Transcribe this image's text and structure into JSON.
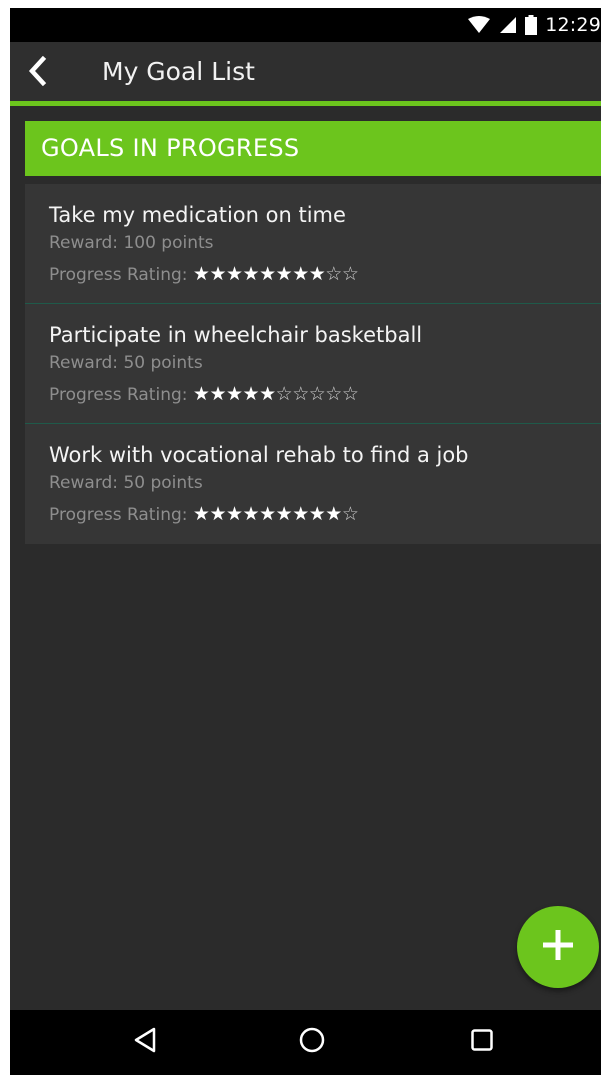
{
  "status_bar": {
    "time": "12:29",
    "icons": [
      "wifi-icon",
      "signal-icon",
      "battery-icon"
    ]
  },
  "toolbar": {
    "back_icon": "chevron-left-icon",
    "title": "My Goal List"
  },
  "section": {
    "title": "GOALS IN PROGRESS"
  },
  "goals": [
    {
      "title": "Take my medication on time",
      "reward": "Reward: 100 points",
      "rating_label": "Progress Rating:",
      "rating_filled": 8,
      "rating_total": 10
    },
    {
      "title": "Participate in wheelchair basketball",
      "reward": "Reward: 50 points",
      "rating_label": "Progress Rating:",
      "rating_filled": 5,
      "rating_total": 10
    },
    {
      "title": "Work with vocational rehab to find a job",
      "reward": "Reward: 50 points",
      "rating_label": "Progress Rating:",
      "rating_filled": 9,
      "rating_total": 10
    }
  ],
  "fab": {
    "icon": "plus-icon"
  },
  "nav_bar": {
    "icons": [
      "nav-back-icon",
      "nav-home-icon",
      "nav-recents-icon"
    ]
  },
  "colors": {
    "accent": "#6cc51d",
    "background": "#2b2b2b",
    "card": "#363636",
    "text_primary": "#f4f4f4",
    "text_secondary": "#8e8e8e"
  }
}
